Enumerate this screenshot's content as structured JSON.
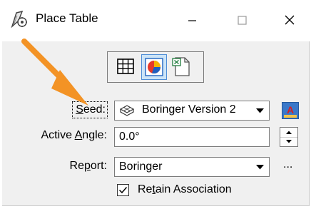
{
  "window": {
    "title": "Place Table",
    "icons": {
      "app": "place-table-icon",
      "minimize": "minimize-icon",
      "maximize": "maximize-icon",
      "close": "close-icon"
    }
  },
  "modes": [
    {
      "name": "table-grid-icon",
      "active": false
    },
    {
      "name": "colored-circle-icon",
      "active": true
    },
    {
      "name": "spreadsheet-file-icon",
      "active": false
    }
  ],
  "form": {
    "seed": {
      "label_pre": "",
      "label_u": "S",
      "label_post": "eed:",
      "value": "Boringer Version 2",
      "icon": "table-seed-icon"
    },
    "text_style_icon": "text-style-icon",
    "active_angle": {
      "label_pre": "Active ",
      "label_u": "A",
      "label_post": "ngle:",
      "value": "0.0°"
    },
    "report": {
      "label_pre": "Re",
      "label_u": "p",
      "label_post": "ort:",
      "value": "Boringer",
      "more": "..."
    },
    "retain": {
      "label_pre": "Re",
      "label_u": "t",
      "label_post": "ain Association",
      "checked": true
    }
  },
  "colors": {
    "accent_arrow": "#f39325",
    "selected_bg": "#cce4f7",
    "selected_border": "#4f8ed7"
  }
}
